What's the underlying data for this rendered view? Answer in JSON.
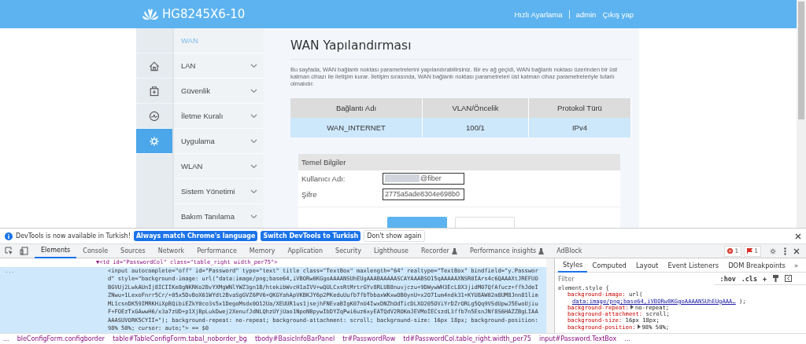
{
  "header": {
    "model": "HG8245X6-10",
    "links": [
      {
        "label": "Hızlı Ayarlama"
      },
      {
        "label": "admin"
      },
      {
        "label": "Çıkış yap"
      }
    ]
  },
  "sidebar": {
    "icons": [
      {
        "kind": "home",
        "selected": false
      },
      {
        "kind": "box",
        "selected": false
      },
      {
        "kind": "gauge",
        "selected": false
      },
      {
        "kind": "gear",
        "selected": true
      }
    ],
    "items": [
      {
        "label": "WAN",
        "selected": true,
        "expandable": false
      },
      {
        "label": "LAN",
        "selected": false,
        "expandable": true
      },
      {
        "label": "Güvenlik",
        "selected": false,
        "expandable": true
      },
      {
        "label": "İletme Kuralı",
        "selected": false,
        "expandable": true
      },
      {
        "label": "Uygulama",
        "selected": false,
        "expandable": true
      },
      {
        "label": "WLAN",
        "selected": false,
        "expandable": true
      },
      {
        "label": "Sistem Yönetimi",
        "selected": false,
        "expandable": true
      },
      {
        "label": "Bakım Tanılama",
        "selected": false,
        "expandable": true
      }
    ]
  },
  "main": {
    "title": "WAN Yapılandırması",
    "description": "Bu sayfada, WAN bağlantı noktası parametrelerini yapılandırabilirsiniz. Bir ev ağ geçidi, WAN bağlantı noktası üzerinden bir üst katman cihazı ile iletişim kurar. İletişim sırasında, WAN bağlantı noktası parametreleri üst katman cihaz parametreleriyle tutarlı olmalıdır.",
    "table": {
      "columns": [
        "Bağlantı Adı",
        "VLAN/Öncelik",
        "Protokol Türü"
      ],
      "rows": [
        {
          "cells": [
            "WAN_INTERNET",
            "100/1",
            "IPv4"
          ],
          "selected": true
        }
      ]
    },
    "form": {
      "title": "Temel Bilgiler",
      "fields": [
        {
          "label": "Kullanıcı Adı:",
          "value": "@fiber",
          "redacted": true
        },
        {
          "label": "Şifre",
          "value": "2775a5ade8304e698b0"
        }
      ]
    },
    "buttons": [
      {
        "kind": "primary"
      },
      {
        "kind": "secondary"
      }
    ]
  },
  "devtools": {
    "infobar": {
      "message": "DevTools is now available in Turkish!",
      "buttons": [
        {
          "label": "Always match Chrome's language",
          "kind": "primary"
        },
        {
          "label": "Switch DevTools to Turkish",
          "kind": "primary"
        },
        {
          "label": "Don't show again",
          "kind": "plain"
        }
      ]
    },
    "tabs": [
      {
        "label": "Elements",
        "selected": true,
        "experimental": false
      },
      {
        "label": "Console",
        "selected": false,
        "experimental": false
      },
      {
        "label": "Sources",
        "selected": false,
        "experimental": false
      },
      {
        "label": "Network",
        "selected": false,
        "experimental": false
      },
      {
        "label": "Performance",
        "selected": false,
        "experimental": false
      },
      {
        "label": "Memory",
        "selected": false,
        "experimental": false
      },
      {
        "label": "Application",
        "selected": false,
        "experimental": false
      },
      {
        "label": "Security",
        "selected": false,
        "experimental": false
      },
      {
        "label": "Lighthouse",
        "selected": false,
        "experimental": false
      },
      {
        "label": "Recorder",
        "selected": false,
        "experimental": true
      },
      {
        "label": "Performance insights",
        "selected": false,
        "experimental": true
      },
      {
        "label": "AdBlock",
        "selected": false,
        "experimental": false
      }
    ],
    "badges": [
      {
        "kind": "error",
        "count": "1"
      },
      {
        "kind": "issue",
        "count": "1"
      }
    ],
    "elements": {
      "nodes": [
        {
          "text": "▼<td id=\"PasswordCol\" class=\"table_right width_per75\">",
          "selected": false,
          "children": [
            {
              "selected": true,
              "gutter": "...",
              "lines": [
                "<input autocomplete=\"off\" id=\"Password\" type=\"text\" title class=\"TextBox\" maxlength=\"64\" realtype=\"TextBox\" bindfield=\"y.Passwor",
                "d\" style=\"background-image: url(\"data:image/png;base64,iVBORw0KGgoAAAANSUhEUgAAABAAAAASCAYAAABSO15qAAAAAXNSR0IArs4c6QAAAXtJREFUO",
                "BGVUj2LwkAUnIj8ICIIKe8gNKRKo2BvYXMgWNlYWZ3gn1B/htekibWvcH1aIVV+wQULCxsRtMrtrGYv8RLUB8nuvjczu+9DWywWH3EcL8X3jidM07QfAfucz+ffhJdeI",
                "ZNwu+1LexoFnrr5Cr/+05x5DvBoX61WYdt2BvaSgGVZ6PV6+QKGYahApVKBKJY6p2PKeduUufb7fbTbbaxWKxwOB0ynU+x2O71um4ndk31+KYU8AW02m8UM8Jnn81lim",
                "ML1csnDK59IMRKHiXpBQibiEZkY0co3s5x1DegoMsdx0O12Ua/XEUUR1us1jsejhFNEvaBIgK07nU4IwxDNZhOdTicDLXO205OViYrDZrORLg5Qq9VSdUpwJ5EwoUjiu",
                "F+FOEzTxGAwwH6/x3a7zUD+p1XjBpLukDwej2XenufJdNLQhzUYjUao1NpoNBpywIbDYZqPwi6uz6xyEATQdV2ROKmJEVMoIECszdL3ffb7n5EsnJNf8S6HAZZBgLIAA",
                "AAASUVORK5CYII=\"); background-repeat: no-repeat; background-attachment: scroll; background-size: 16px 18px; background-position:",
                "98% 50%; cursor: auto;\"> == $0"
              ]
            }
          ]
        }
      ]
    },
    "styles": {
      "tabs": [
        {
          "label": "Styles",
          "selected": true
        },
        {
          "label": "Computed",
          "selected": false
        },
        {
          "label": "Layout",
          "selected": false
        },
        {
          "label": "Event Listeners",
          "selected": false
        },
        {
          "label": "DOM Breakpoints",
          "selected": false
        }
      ],
      "more": "»",
      "filter": {
        "placeholder": "Filter"
      },
      "tools": [
        ":hov",
        ".cls",
        "+"
      ],
      "selector": "element.style {",
      "declarations": [
        {
          "property": "background-image:",
          "value": "url("
        },
        {
          "link": "data:image/png;base64,iVBORw0KGgoAAAANSUhEUgAAA…",
          "tail": ");"
        },
        {
          "property": "background-repeat:",
          "value": "no-repeat;",
          "expandable": true
        },
        {
          "property": "background-attachment:",
          "value": "scroll;"
        },
        {
          "property": "background-size:",
          "value": "16px 18px;"
        },
        {
          "property": "background-position:",
          "value": "98% 50%;",
          "expandable": true
        }
      ]
    },
    "breadcrumbs": [
      "...",
      "bleConfigForm.configborder",
      "table#TableConfigForm.tabal_noborder_bg",
      "tbody#BasicInfoBarPanel",
      "tr#PasswordRow",
      "td#PasswordCol.table_right.width_per75",
      "input#Password.TextBox",
      "..."
    ]
  }
}
